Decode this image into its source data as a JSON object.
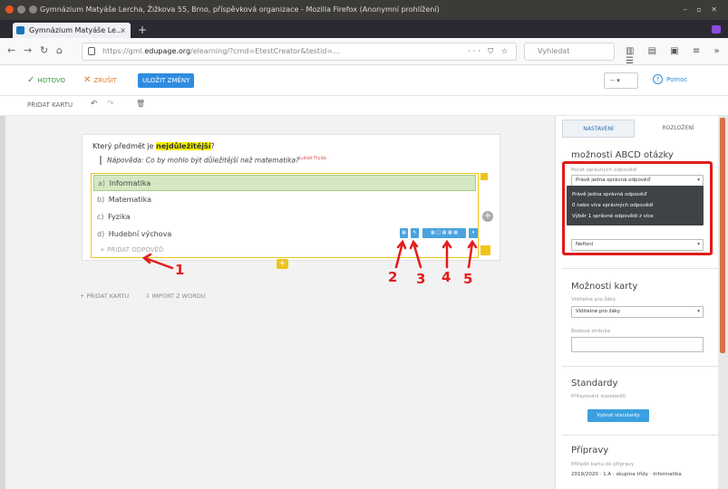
{
  "window": {
    "title": "Gymnázium Matyáše Lercha, Žižkova 55, Brno, příspěvková organizace - Mozilla Firefox (Anonymní prohlížení)",
    "controls": "–  ▫  ✕"
  },
  "tab": {
    "label": "Gymnázium Matyáše Le...",
    "close": "×",
    "new": "+"
  },
  "url": {
    "prefix": "https://gml.",
    "domain": "edupage.org",
    "rest": "/elearning/?cmd=EtestCreator&testid=...",
    "tools": "··· ⛉ ☆",
    "search_placeholder": "Vyhledat"
  },
  "appbar": {
    "ok": "HOTOVO",
    "cancel": "ZRUŠIT",
    "save": "ULOŽIT ZMĚNY",
    "lang": "--",
    "help": "Pomoc"
  },
  "toolbar": {
    "add_card": "PŘIDAT KARTU",
    "undo": "↶",
    "redo": "↷",
    "delete": "🗑"
  },
  "question": {
    "text_before": "Který předmět je ",
    "highlight": "nejdůležitější",
    "text_after": "?",
    "hint": "Nápověda: Co by mohlo být důležitější než matematika?",
    "hint_sup": "Lukáš Fryda"
  },
  "answers": [
    {
      "prefix": "a)",
      "label": "Informatika",
      "correct": true
    },
    {
      "prefix": "b)",
      "label": "Matematika",
      "correct": false
    },
    {
      "prefix": "c)",
      "label": "Fyzika",
      "correct": false
    },
    {
      "prefix": "d)",
      "label": "Hudební výchova",
      "correct": false
    }
  ],
  "add_answer": "+ PŘIDAT ODPOVĚĎ",
  "controls": {
    "b2": "▦",
    "b3": "✎",
    "b4": "▦ □ ▦ ▦ ▦",
    "b5": "▾"
  },
  "annotations": [
    "1",
    "2",
    "3",
    "4",
    "5"
  ],
  "below_card": {
    "add": "+ PŘIDAT KARTU",
    "import": "⇩ IMPORT Z WORDU"
  },
  "sidebar": {
    "tab_settings": "NASTAVENÍ",
    "tab_layout": "ROZLOŽENÍ",
    "abcd_title": "možnosti ABCD otázky",
    "abcd_label": "Počet správných odpovědí",
    "abcd_value": "Právě jedna správná odpověď",
    "options": [
      "Právě jedna správná odpověď",
      "0 nebo více správných odpovědí",
      "Výběr 1 správné odpovědi z více"
    ],
    "second_value": "Nefixní",
    "card_title": "Možnosti karty",
    "card_label": "Viditelné pro žáky",
    "card_value": "Viditelné pro žáky",
    "points_label": "Bodová stránka",
    "standards_title": "Standardy",
    "standards_label": "Přiřazování standardů",
    "standards_button": "Vybrat standardy",
    "prep_title": "Přípravy",
    "prep_label": "Přiřadit kartu do přípravy",
    "prep_value": "2019/2020 · 1.A · skupina třídy · Informatika"
  }
}
